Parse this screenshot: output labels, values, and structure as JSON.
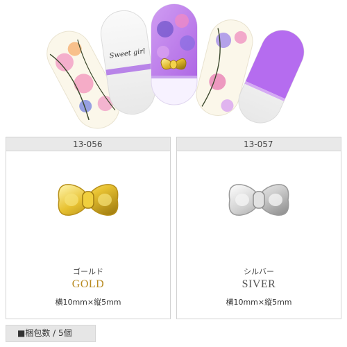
{
  "hero": {
    "nail_script_text": "Sweet girl"
  },
  "products": [
    {
      "code": "13-056",
      "kana": "ゴールド",
      "name": "GOLD",
      "size": "横10mm×縦5mm",
      "color": "#d9b52a"
    },
    {
      "code": "13-057",
      "kana": "シルバー",
      "name": "SIVER",
      "size": "横10mm×縦5mm",
      "color": "#c9c9c9"
    }
  ],
  "package": {
    "label": "■梱包数 / 5個"
  }
}
